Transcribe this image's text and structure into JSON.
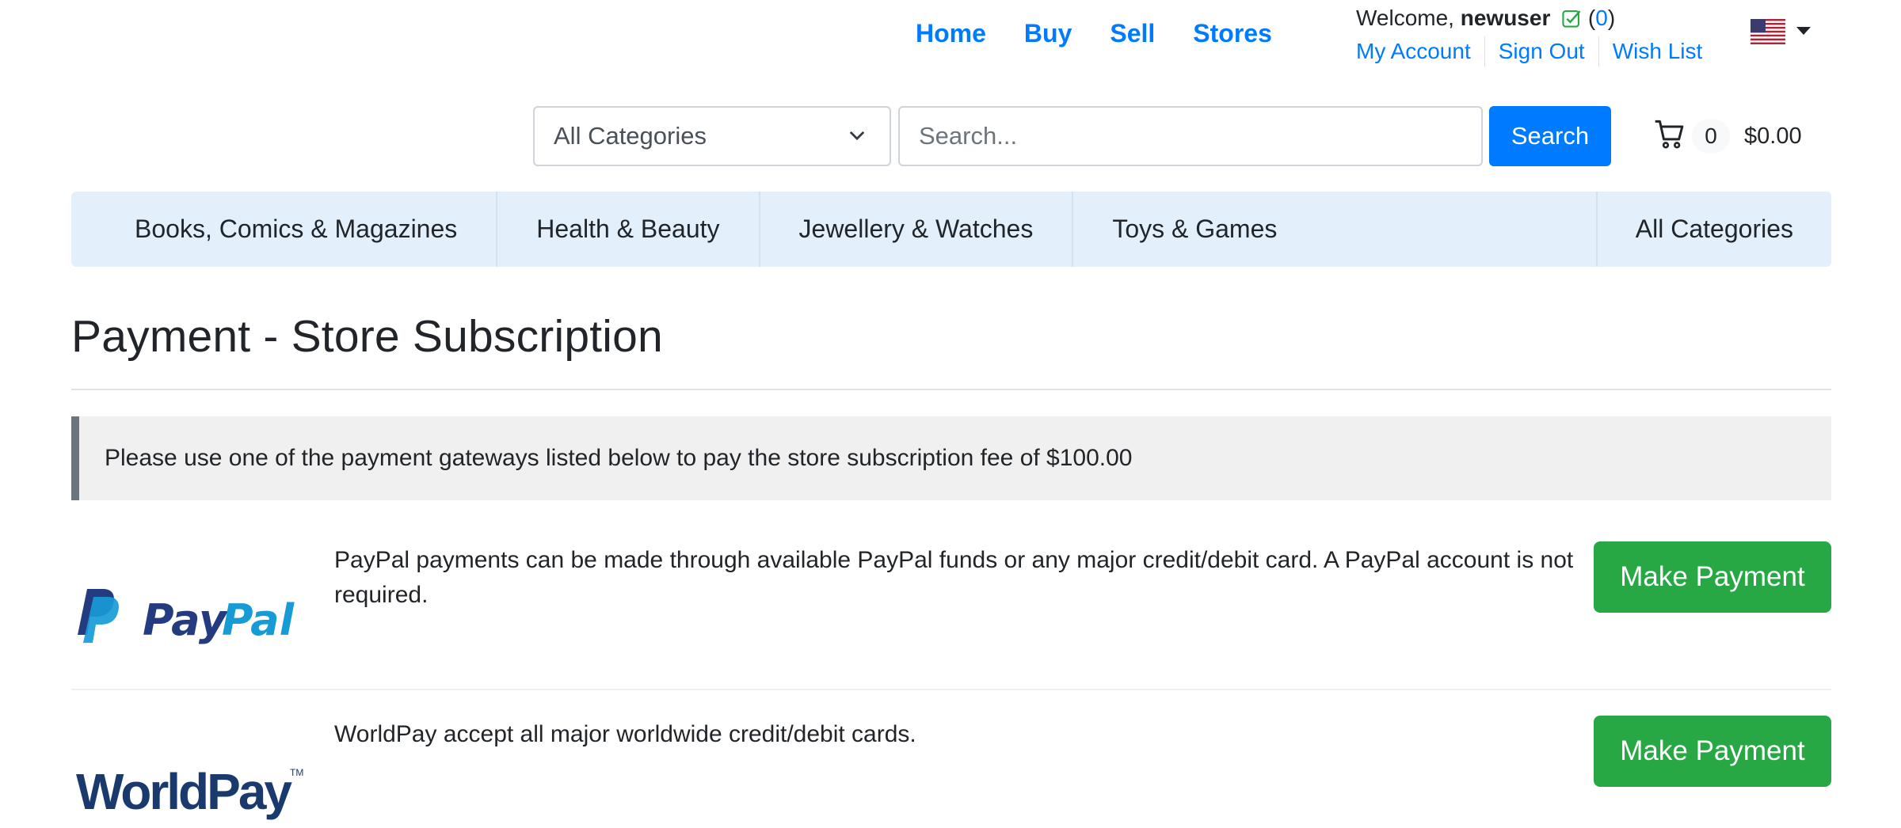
{
  "top_nav": {
    "home": "Home",
    "buy": "Buy",
    "sell": "Sell",
    "stores": "Stores"
  },
  "user": {
    "welcome_prefix": "Welcome,",
    "username": "newuser",
    "badge_open": "(",
    "message_count": "0",
    "badge_close": ")",
    "verified_icon": "check-square-icon"
  },
  "account_links": {
    "my_account": "My Account",
    "sign_out": "Sign Out",
    "wish_list": "Wish List"
  },
  "locale": {
    "flag_icon": "us-flag-icon"
  },
  "search": {
    "category_selected": "All Categories",
    "placeholder": "Search...",
    "button_label": "Search"
  },
  "cart": {
    "icon": "cart-icon",
    "count": "0",
    "total": "$0.00"
  },
  "categories": {
    "items": [
      "Books, Comics & Magazines",
      "Health & Beauty",
      "Jewellery & Watches",
      "Toys & Games"
    ],
    "all": "All Categories"
  },
  "page": {
    "title": "Payment - Store Subscription",
    "notice": "Please use one of the payment gateways listed below to pay the store subscription fee of $100.00"
  },
  "gateways": [
    {
      "logo_icon": "paypal-logo",
      "description": "PayPal payments can be made through available PayPal funds or any major credit/debit card. A PayPal account is not required.",
      "button_label": "Make Payment"
    },
    {
      "logo_icon": "worldpay-logo",
      "description": "WorldPay accept all major worldwide credit/debit cards.",
      "button_label": "Make Payment"
    }
  ],
  "colors": {
    "primary": "#007bff",
    "success": "#28a745",
    "category_bar": "#e3f0fc",
    "paypal_dark": "#253b80",
    "paypal_light": "#179bd7",
    "worldpay": "#1a3a6e"
  }
}
